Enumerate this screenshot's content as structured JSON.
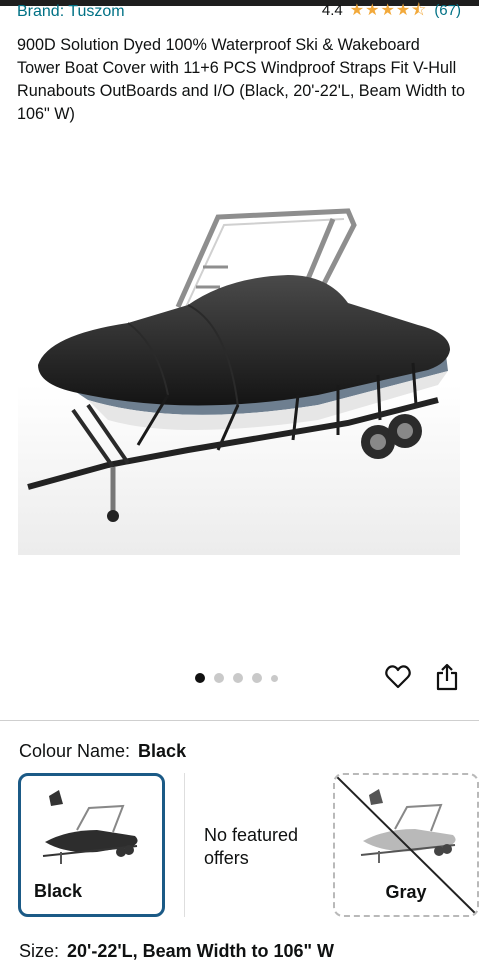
{
  "product": {
    "brand": "Brand: Tuszom",
    "rating_value": "4.4",
    "rating_stars": 4.4,
    "rating_count": "(67)",
    "title": "900D Solution Dyed 100% Waterproof Ski & Wakeboard Tower Boat Cover with 11+6 PCS Windproof Straps Fit V-Hull Runabouts OutBoards and I/O (Black, 20'-22'L, Beam Width to 106\" W)"
  },
  "gallery": {
    "image_count": 5,
    "active_index": 0
  },
  "icons": {
    "wishlist": "heart-icon",
    "share": "share-icon",
    "stars": "star-icon"
  },
  "colour": {
    "label": "Colour Name:",
    "selected": "Black",
    "options": [
      {
        "name": "Black",
        "selected": true,
        "available": true
      },
      {
        "name": "No featured offers",
        "selected": false,
        "available": false
      },
      {
        "name": "Gray",
        "selected": false,
        "available": false
      }
    ]
  },
  "size": {
    "label": "Size:",
    "selected": "20'-22'L, Beam Width to 106\" W"
  },
  "colors": {
    "link": "#007185",
    "star": "#f2a93b",
    "selected_border": "#1b5a86",
    "text": "#0f1111"
  }
}
